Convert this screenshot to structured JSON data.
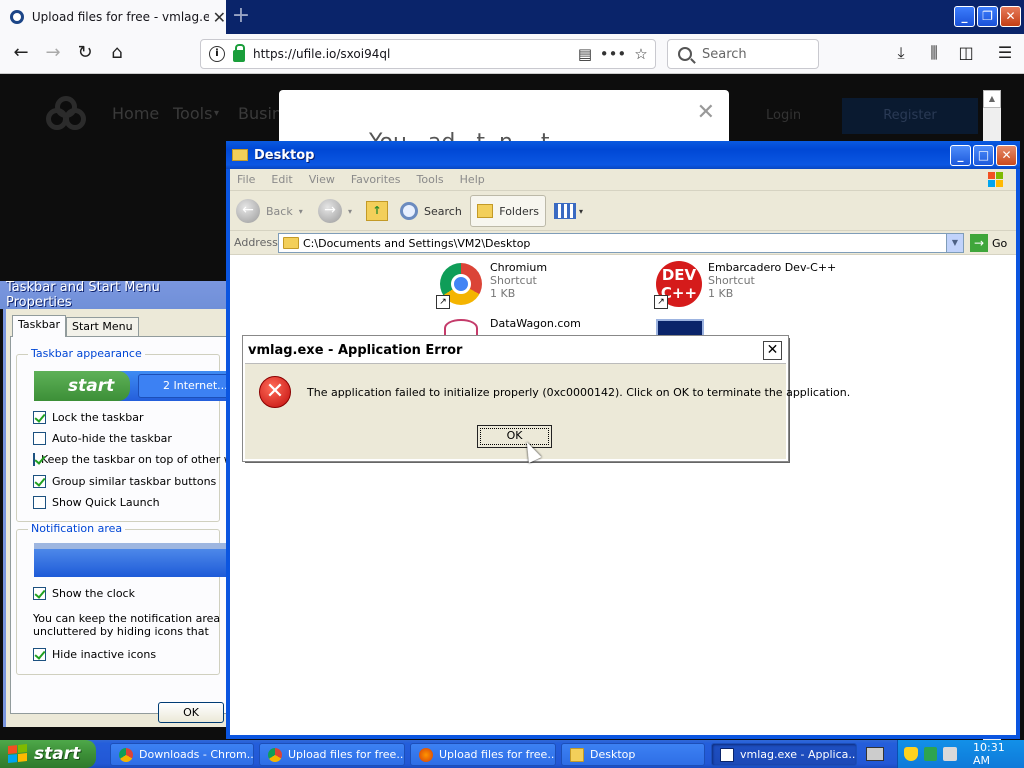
{
  "browser": {
    "tab_title": "Upload files for free - vmlag.exe -",
    "url": "https://ufile.io/sxoi94ql",
    "search_placeholder": "Search"
  },
  "webpage": {
    "nav": [
      "Home",
      "Tools",
      "Busin"
    ],
    "tools_caret": "▾",
    "modal_text": "You ..ad ..t..n. ..t..",
    "login": "Login",
    "register": "Register"
  },
  "taskbar_props": {
    "title": "Taskbar and Start Menu Properties",
    "tabs": [
      "Taskbar",
      "Start Menu"
    ],
    "group_appearance": "Taskbar appearance",
    "preview_start": "start",
    "preview_ie": "2 Internet...",
    "options": [
      {
        "label": "Lock the taskbar",
        "checked": true
      },
      {
        "label": "Auto-hide the taskbar",
        "checked": false
      },
      {
        "label": "Keep the taskbar on top of other windows",
        "checked": true
      },
      {
        "label": "Group similar taskbar buttons",
        "checked": true
      },
      {
        "label": "Show Quick Launch",
        "checked": false
      }
    ],
    "group_notification": "Notification area",
    "show_clock": "Show the clock",
    "notification_note": "You can keep the notification area uncluttered by hiding icons that you have not clicked recently.",
    "hide_inactive": "Hide inactive icons",
    "ok_label": "OK"
  },
  "explorer": {
    "title": "Desktop",
    "menu": [
      "File",
      "Edit",
      "View",
      "Favorites",
      "Tools",
      "Help"
    ],
    "toolbar": {
      "back": "Back",
      "search": "Search",
      "folders": "Folders"
    },
    "address_label": "Address",
    "address_path": "C:\\Documents and Settings\\VM2\\Desktop",
    "go_label": "Go",
    "items": [
      {
        "name": "Chromium",
        "type": "Shortcut",
        "size": "1 KB"
      },
      {
        "name": "Embarcadero Dev-C++",
        "type": "Shortcut",
        "size": "1 KB"
      },
      {
        "name": "DataWagon.com",
        "type": "",
        "size": ""
      }
    ]
  },
  "error_dialog": {
    "title": "vmlag.exe - Application Error",
    "message": "The application failed to initialize properly (0xc0000142). Click on OK to terminate the application.",
    "ok_label": "OK"
  },
  "taskbar": {
    "start_label": "start",
    "tasks": [
      {
        "label": "Downloads - Chrom..."
      },
      {
        "label": "Upload files for free..."
      },
      {
        "label": "Upload files for free..."
      },
      {
        "label": "Desktop"
      },
      {
        "label": "vmlag.exe - Applica..."
      }
    ],
    "clock": "10:31 AM"
  }
}
